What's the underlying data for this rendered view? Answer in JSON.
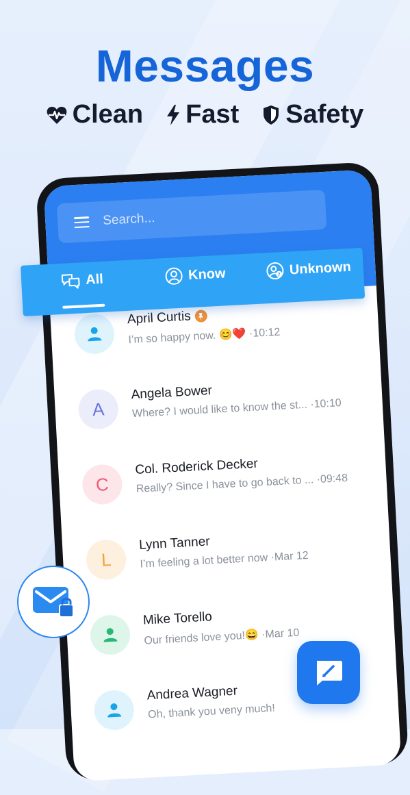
{
  "headline": "Messages",
  "features": [
    {
      "icon": "heart-pulse-icon",
      "label": "Clean"
    },
    {
      "icon": "bolt-icon",
      "label": "Fast"
    },
    {
      "icon": "shield-icon",
      "label": "Safety"
    }
  ],
  "search": {
    "placeholder": "Search..."
  },
  "tabs": [
    {
      "icon": "chat-bubbles-icon",
      "label": "All",
      "active": true
    },
    {
      "icon": "person-circle-icon",
      "label": "Know",
      "active": false
    },
    {
      "icon": "unknown-person-icon",
      "label": "Unknown",
      "active": false
    }
  ],
  "conversations": [
    {
      "name": "April Curtis",
      "pinned": true,
      "preview": "I’m so happy now. 😊❤️ ·10:12",
      "avatar": "person-icon",
      "avatar_bg": "#dff3fd",
      "avatar_color": "#1aa3e8"
    },
    {
      "name": "Angela Bower",
      "pinned": false,
      "preview": "Where? I would like to know the st... ·10:10",
      "avatar": "A",
      "avatar_bg": "#ecedfb",
      "avatar_color": "#6b73e0"
    },
    {
      "name": "Col. Roderick Decker",
      "pinned": false,
      "preview": "Really? Since I have to go back to ... ·09:48",
      "avatar": "C",
      "avatar_bg": "#fde6ea",
      "avatar_color": "#ef5a73"
    },
    {
      "name": "Lynn Tanner",
      "pinned": false,
      "preview": "I’m feeling a lot better now ·Mar 12",
      "avatar": "L",
      "avatar_bg": "#fdf0de",
      "avatar_color": "#f3a23a"
    },
    {
      "name": "Mike Torello",
      "pinned": false,
      "preview": "Our friends love you!😄 ·Mar 10",
      "avatar": "person-icon",
      "avatar_bg": "#def5ea",
      "avatar_color": "#27b873"
    },
    {
      "name": "Andrea Wagner",
      "pinned": false,
      "preview": "Oh, thank you veny much!",
      "avatar": "person-icon",
      "avatar_bg": "#dff3fd",
      "avatar_color": "#1aa3e8"
    }
  ],
  "colors": {
    "brand": "#1565d8",
    "tab_bar": "#2fa3f6",
    "header": "#2c7ff0"
  }
}
